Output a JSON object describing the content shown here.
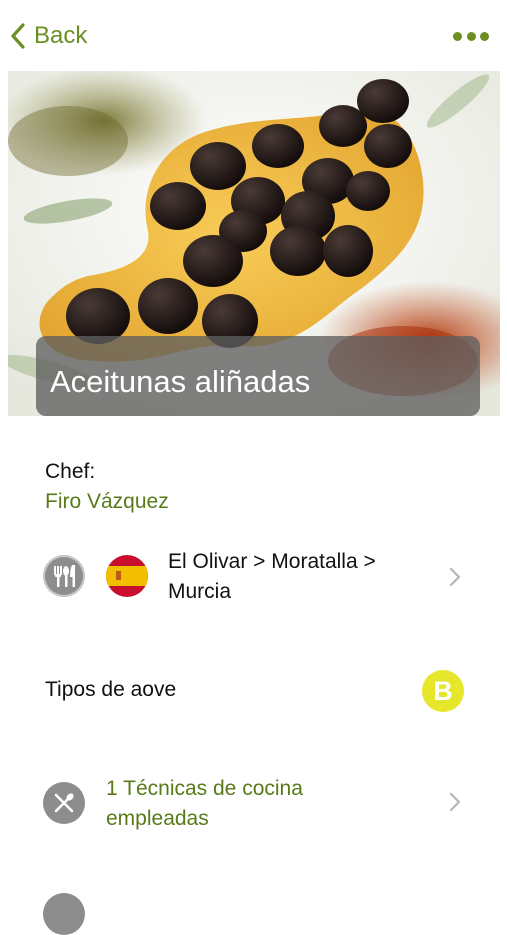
{
  "nav": {
    "back_label": "Back",
    "back_icon": "chevron-left-icon",
    "more_icon": "more-dots-icon",
    "accent": "#6b8f23"
  },
  "hero": {
    "title": "Aceitunas aliñadas"
  },
  "chef": {
    "label": "Chef:",
    "name": "Firo Vázquez"
  },
  "location": {
    "text": "El Olivar > Moratalla > Murcia",
    "flag": "spain-flag-icon",
    "icon": "cutlery-icon"
  },
  "aove": {
    "label": "Tipos de aove",
    "badge": "B",
    "badge_color": "#e6e62a"
  },
  "techniques": {
    "text": "1 Técnicas de cocina empleadas",
    "icon": "utensils-icon"
  }
}
